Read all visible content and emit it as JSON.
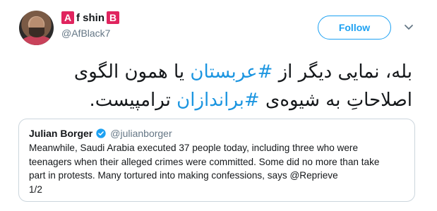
{
  "tweet": {
    "author": {
      "badge_left": "A",
      "name_middle": "f shin",
      "badge_right": "B",
      "handle": "@AfBlack7"
    },
    "follow_label": "Follow",
    "text_parts": [
      {
        "text": "بله، نمایی دیگر از ",
        "hashtag": false
      },
      {
        "text": "#عربستان",
        "hashtag": true
      },
      {
        "text": " یا همون الگوی اصلاحاتِ به شیوه‌ی ",
        "hashtag": false
      },
      {
        "text": "#براندازان",
        "hashtag": true
      },
      {
        "text": " ترامپیست.",
        "hashtag": false
      }
    ]
  },
  "quoted": {
    "name": "Julian Borger",
    "handle": "@julianborger",
    "text": "Meanwhile, Saudi Arabia executed 37 people today, including three who were\nteenagers when their alleged crimes were committed. Some did no more than take\npart in protests. Many tortured into making confessions, says  @Reprieve\n1/2"
  },
  "colors": {
    "accent": "#1da1f2",
    "badge": "#e0245e",
    "border": "#ccd6dd",
    "muted": "#657786"
  },
  "icons": {
    "caret": "chevron-down-icon",
    "verified": "verified-badge-icon"
  }
}
